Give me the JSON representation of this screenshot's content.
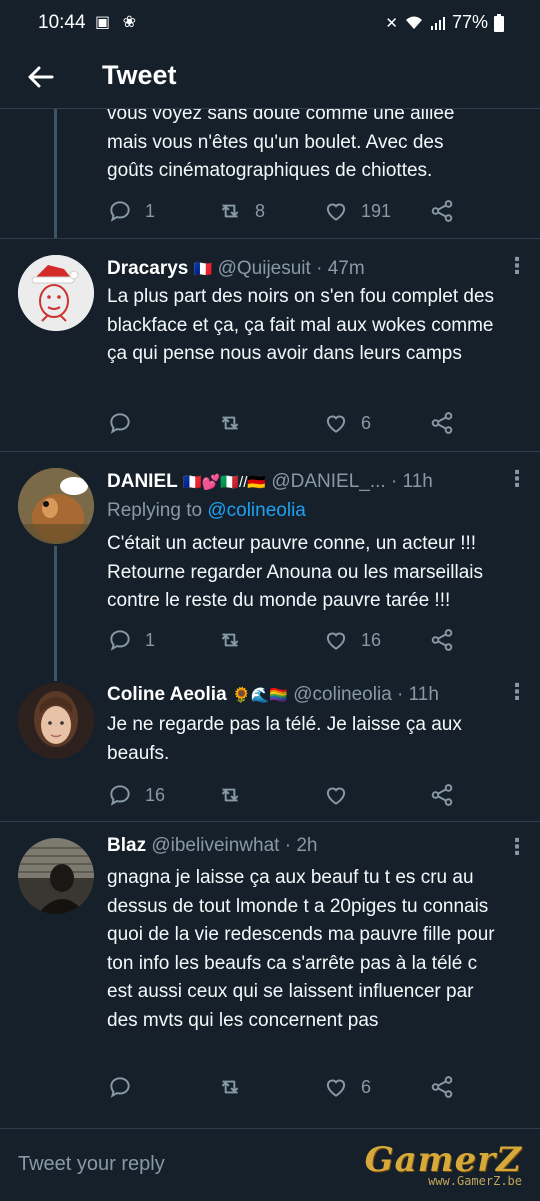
{
  "status_bar": {
    "time": "10:44",
    "battery": "77%"
  },
  "header": {
    "title": "Tweet"
  },
  "partial_tweet": {
    "lines": [
      "vous voyez sans doute comme une alliée",
      "mais vous n'êtes qu'un boulet. Avec des",
      "goûts cinématographiques de chiottes."
    ],
    "replies": "1",
    "retweets": "8",
    "likes": "191"
  },
  "tweets": [
    {
      "name": "Dracarys",
      "flags": "🇫🇷",
      "handle": "@Quijesuit",
      "time": "· 47m",
      "text": "La plus part des noirs on s'en fou complet des blackface et ça, ça fait mal aux wokes comme ça qui pense nous avoir dans leurs camps",
      "replies": "",
      "retweets": "",
      "likes": "6"
    },
    {
      "name": "DANIEL",
      "flags": "🇫🇷💕🇮🇹//🇩🇪",
      "handle": "@DANIEL_...",
      "time": "· 11h",
      "replying_label": "Replying to",
      "replying_mention": "@colineolia",
      "text": "C'était un acteur pauvre conne, un acteur !!! Retourne regarder Anouna ou les marseillais contre le reste du monde pauvre tarée !!!",
      "replies": "1",
      "retweets": "",
      "likes": "16"
    },
    {
      "name": "Coline Aeolia",
      "flags": "🌻🌊🏳️‍🌈",
      "handle": "@colineolia",
      "time": "· 11h",
      "text": "Je ne regarde pas la télé. Je laisse ça aux beaufs.",
      "replies": "16",
      "retweets": "",
      "likes": ""
    },
    {
      "name": "Blaz",
      "flags": "",
      "handle": "@ibeliveinwhat",
      "time": "· 2h",
      "text": "gnagna je laisse ça aux beauf tu t es cru au dessus de tout lmonde t a 20piges tu connais quoi de la vie redescends ma pauvre fille pour ton info les beaufs ca s'arrête pas à la télé c est aussi ceux qui se laissent influencer par des mvts qui les concernent pas",
      "replies": "",
      "retweets": "",
      "likes": "6"
    }
  ],
  "reply_bar": {
    "placeholder": "Tweet your reply"
  },
  "watermark": {
    "brand": "GamerZ",
    "url": "www.GamerZ.be"
  },
  "colors": {
    "background": "#15202b",
    "muted": "#8899a6",
    "accent": "#1da1f2",
    "divider": "#2f3d4c"
  },
  "icons": [
    "back-arrow-icon",
    "reply-icon",
    "retweet-icon",
    "like-icon",
    "share-icon",
    "more-icon"
  ]
}
